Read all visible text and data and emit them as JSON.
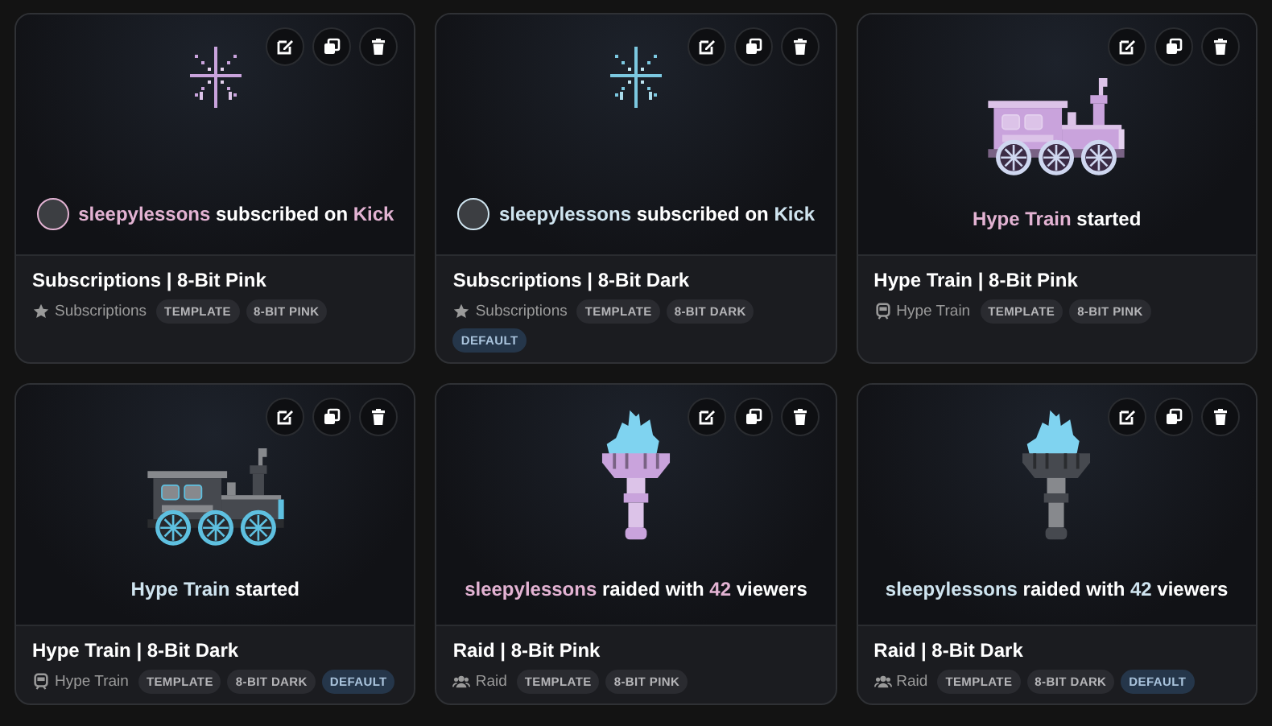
{
  "cards": [
    {
      "kind": "subscription",
      "color": "#c9a3dc",
      "avatar": true,
      "message": [
        {
          "text": "sleepylessons",
          "highlight": true
        },
        {
          "text": " subscribed on ",
          "highlight": false
        },
        {
          "text": "Kick",
          "highlight": true
        }
      ],
      "title": "Subscriptions | 8-Bit Pink",
      "category": "Subscriptions",
      "tags": [
        {
          "label": "TEMPLATE",
          "kind": "plain"
        },
        {
          "label": "8-BIT PINK",
          "kind": "plain"
        }
      ]
    },
    {
      "kind": "subscription",
      "color": "#7cc8e0",
      "avatar": true,
      "message": [
        {
          "text": "sleepylessons",
          "highlight": true
        },
        {
          "text": " subscribed on ",
          "highlight": false
        },
        {
          "text": "Kick",
          "highlight": true
        }
      ],
      "title": "Subscriptions | 8-Bit Dark",
      "category": "Subscriptions",
      "tags": [
        {
          "label": "TEMPLATE",
          "kind": "plain"
        },
        {
          "label": "8-BIT DARK",
          "kind": "plain"
        },
        {
          "label": "DEFAULT",
          "kind": "default"
        }
      ]
    },
    {
      "kind": "hypetrain",
      "color": "#c9a3dc",
      "message": [
        {
          "text": "Hype Train",
          "highlight": true
        },
        {
          "text": " started",
          "highlight": false
        }
      ],
      "title": "Hype Train | 8-Bit Pink",
      "category": "Hype Train",
      "tags": [
        {
          "label": "TEMPLATE",
          "kind": "plain"
        },
        {
          "label": "8-BIT PINK",
          "kind": "plain"
        }
      ]
    },
    {
      "kind": "hypetrain",
      "color": "#46494f",
      "message": [
        {
          "text": "Hype Train",
          "highlight": true
        },
        {
          "text": " started",
          "highlight": false
        }
      ],
      "title": "Hype Train | 8-Bit Dark",
      "category": "Hype Train",
      "tags": [
        {
          "label": "TEMPLATE",
          "kind": "plain"
        },
        {
          "label": "8-BIT DARK",
          "kind": "plain"
        },
        {
          "label": "DEFAULT",
          "kind": "default"
        }
      ]
    },
    {
      "kind": "raid",
      "color": "#c9a3dc",
      "message": [
        {
          "text": "sleepylessons",
          "highlight": true
        },
        {
          "text": " raided with ",
          "highlight": false
        },
        {
          "text": "42",
          "highlight": true
        },
        {
          "text": " viewers",
          "highlight": false
        }
      ],
      "title": "Raid | 8-Bit Pink",
      "category": "Raid",
      "tags": [
        {
          "label": "TEMPLATE",
          "kind": "plain"
        },
        {
          "label": "8-BIT PINK",
          "kind": "plain"
        }
      ]
    },
    {
      "kind": "raid",
      "color": "#46494f",
      "message": [
        {
          "text": "sleepylessons",
          "highlight": true
        },
        {
          "text": " raided with ",
          "highlight": false
        },
        {
          "text": "42",
          "highlight": true
        },
        {
          "text": " viewers",
          "highlight": false
        }
      ],
      "title": "Raid | 8-Bit Dark",
      "category": "Raid",
      "tags": [
        {
          "label": "TEMPLATE",
          "kind": "plain"
        },
        {
          "label": "8-BIT DARK",
          "kind": "plain"
        },
        {
          "label": "DEFAULT",
          "kind": "default"
        }
      ]
    }
  ]
}
